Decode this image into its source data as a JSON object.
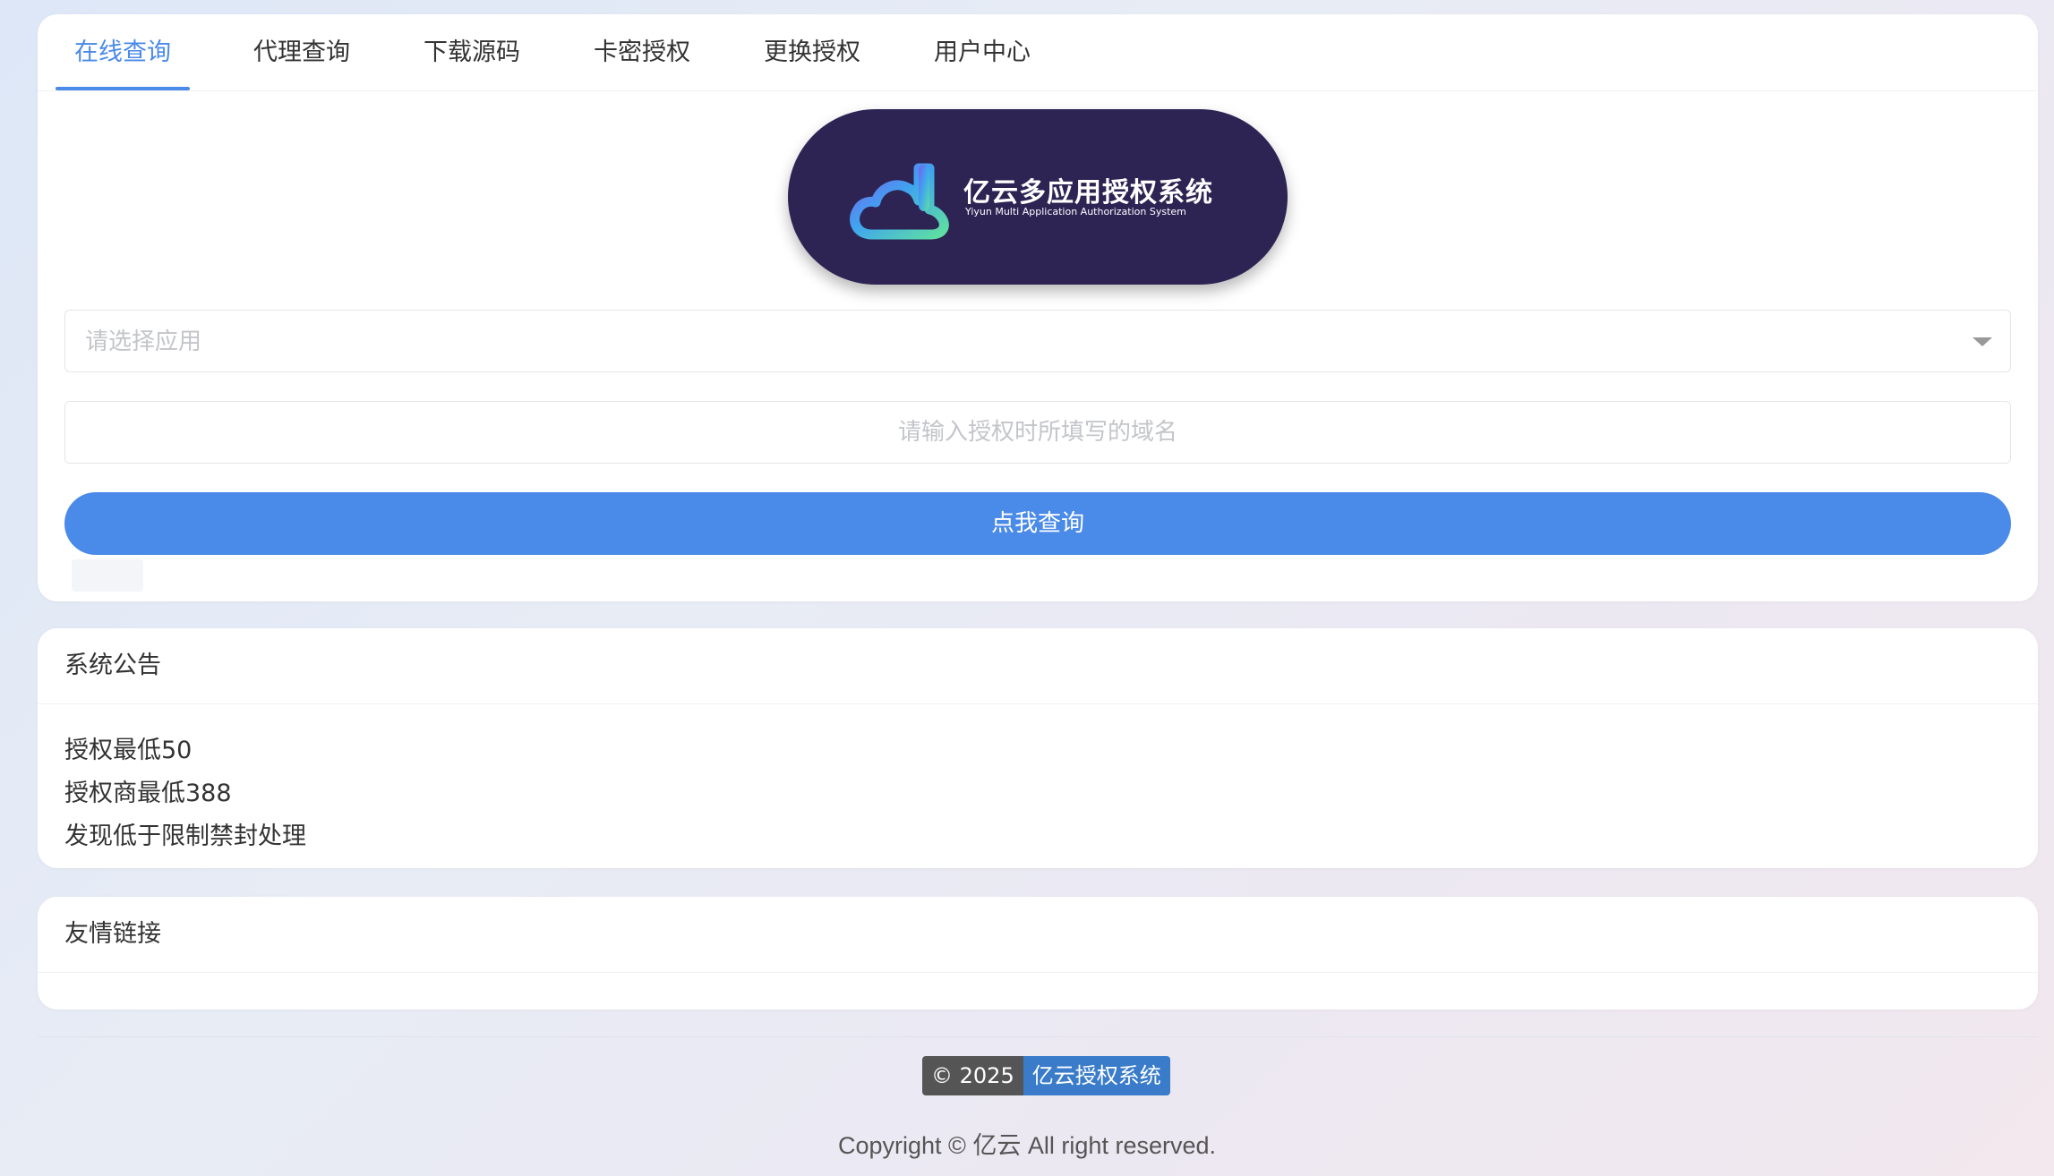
{
  "tabs": [
    {
      "label": "在线查询",
      "active": true
    },
    {
      "label": "代理查询"
    },
    {
      "label": "下载源码"
    },
    {
      "label": "卡密授权"
    },
    {
      "label": "更换授权"
    },
    {
      "label": "用户中心"
    }
  ],
  "logo": {
    "title": "亿云多应用授权系统",
    "subtitle": "Yiyun Multi Application Authorization System"
  },
  "query": {
    "app_select_placeholder": "请选择应用",
    "domain_placeholder": "请输入授权时所填写的域名",
    "button_label": "点我查询"
  },
  "notice": {
    "title": "系统公告",
    "lines": [
      "授权最低50",
      "授权商最低388",
      "发现低于限制禁封处理"
    ]
  },
  "links": {
    "title": "友情链接"
  },
  "footer": {
    "badge_year": "© 2025",
    "badge_name": "亿云授权系统",
    "copyright": "Copyright © 亿云 All right reserved."
  },
  "colors": {
    "accent": "#4a8ae8",
    "logo_bg": "#2d2454",
    "badge_dark": "#555555",
    "badge_blue": "#3a7cc9"
  }
}
